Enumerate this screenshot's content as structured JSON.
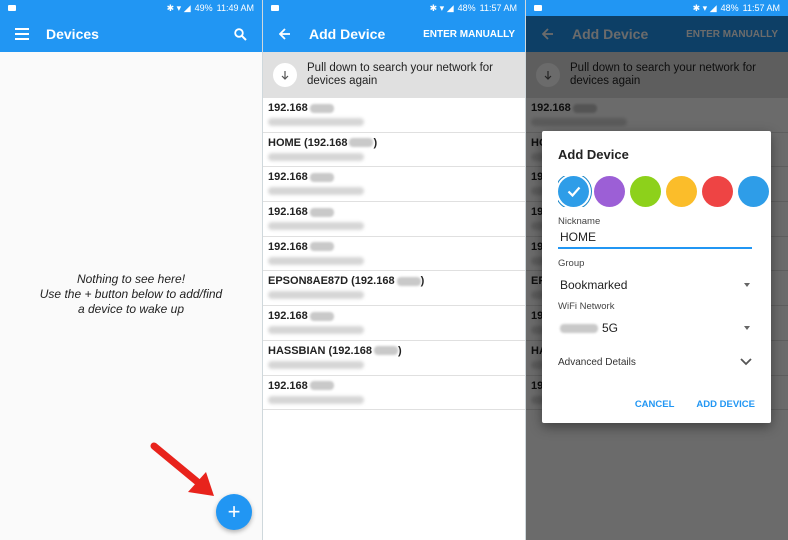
{
  "status_bar_left": {
    "battery": "49%",
    "time": "11:49 AM"
  },
  "status_bar_right": {
    "battery": "48%",
    "time": "11:57 AM"
  },
  "devices_screen": {
    "title": "Devices",
    "empty_message": "Nothing to see here!\nUse the + button below to add/find a device to wake up",
    "fab_label": "+"
  },
  "add_device_screen": {
    "title": "Add Device",
    "enter_manually": "ENTER MANUALLY",
    "pull_hint": "Pull down to search your network for devices again",
    "devices": [
      {
        "name": "192.168"
      },
      {
        "name": "HOME (192.168",
        "suffix": ")"
      },
      {
        "name": "192.168"
      },
      {
        "name": "192.168"
      },
      {
        "name": "192.168"
      },
      {
        "name": "EPSON8AE87D (192.168",
        "suffix": ")"
      },
      {
        "name": "192.168"
      },
      {
        "name": "HASSBIAN (192.168",
        "suffix": ")"
      },
      {
        "name": "192.168"
      }
    ]
  },
  "dialog": {
    "title": "Add Device",
    "colors": [
      "#2e9de8",
      "#9c5fd6",
      "#8dd11b",
      "#fbbd2a",
      "#ee4444",
      "#2e9de8"
    ],
    "nickname_label": "Nickname",
    "nickname_value": "HOME",
    "group_label": "Group",
    "group_value": "Bookmarked",
    "wifi_label": "WiFi Network",
    "wifi_value": "5G",
    "advanced_label": "Advanced Details",
    "cancel": "CANCEL",
    "add": "ADD DEVICE"
  }
}
